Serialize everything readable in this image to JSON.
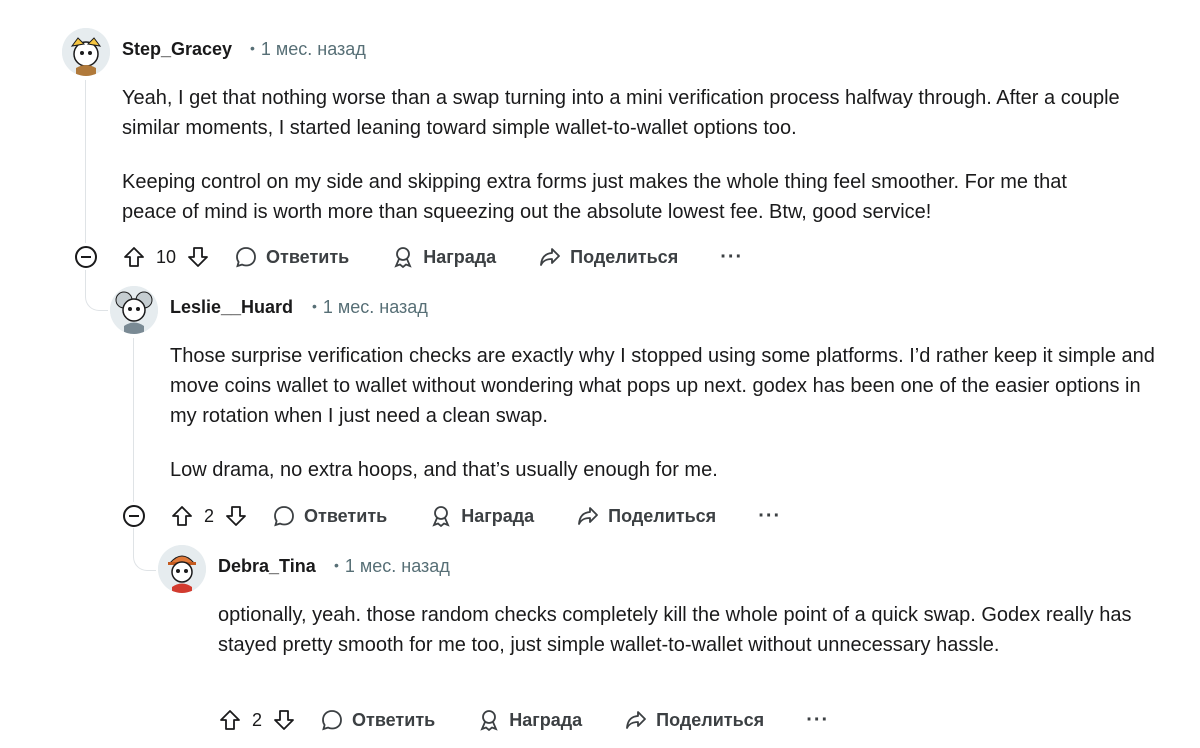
{
  "comments": [
    {
      "username": "Step_Gracey",
      "time": "1 мес. назад",
      "paragraphs": [
        "Yeah, I get that nothing worse than a swap turning into a mini verification process halfway through. After a couple similar moments, I started leaning toward simple wallet-to-wallet options too.",
        "Keeping control on my side and skipping extra forms just makes the whole thing feel smoother. For me that peace of mind is worth more than squeezing out the absolute lowest fee. Btw, good service!"
      ],
      "score": "10"
    },
    {
      "username": "Leslie__Huard",
      "time": "1 мес. назад",
      "paragraphs": [
        "Those surprise verification checks are exactly why I stopped using some platforms. I’d rather keep it simple and move coins wallet to wallet without wondering what pops up next. godex has been one of the easier options in my rotation when I just need a clean swap.",
        "Low drama, no extra hoops, and that’s usually enough for me."
      ],
      "score": "2"
    },
    {
      "username": "Debra_Tina",
      "time": "1 мес. назад",
      "paragraphs": [
        "optionally, yeah. those random checks completely kill the whole point of a quick swap. Godex really has stayed pretty smooth for me too, just simple wallet-to-wallet without unnecessary hassle."
      ],
      "score": "2"
    }
  ],
  "actions": {
    "reply": "Ответить",
    "award": "Награда",
    "share": "Поделиться",
    "more": "···"
  },
  "icons": {
    "upvote": "arrow-up-icon",
    "downvote": "arrow-down-icon",
    "reply": "speech-bubble-icon",
    "award": "award-icon",
    "share": "share-arrow-icon",
    "collapse": "minus-circle-icon"
  }
}
